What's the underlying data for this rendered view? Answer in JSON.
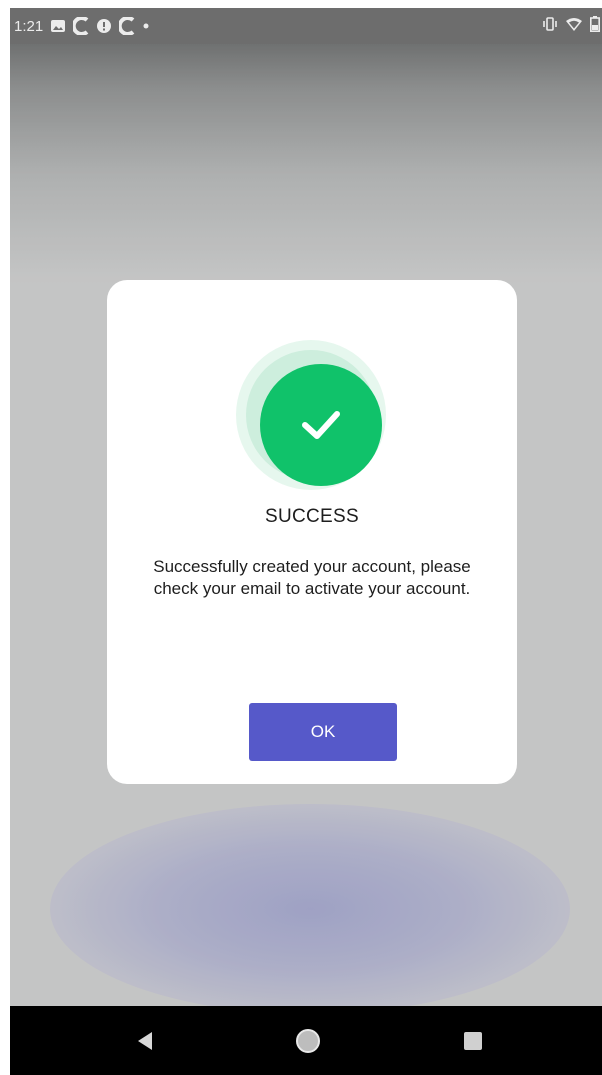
{
  "status_bar": {
    "time": "1:21",
    "left_icons": [
      "image-icon",
      "c-app-icon",
      "alert-circle-icon",
      "c-app-icon",
      "dot-icon"
    ],
    "right_icons": [
      "vibrate-icon",
      "wifi-icon",
      "battery-icon"
    ]
  },
  "dialog": {
    "icon": "check-icon",
    "title": "SUCCESS",
    "message": "Successfully created your account, please check your email to activate your account.",
    "ok_label": "OK",
    "colors": {
      "accent": "#5659c9",
      "success": "#10c26a"
    }
  },
  "nav_bar": {
    "buttons": [
      "back-icon",
      "home-icon",
      "recents-icon"
    ]
  }
}
